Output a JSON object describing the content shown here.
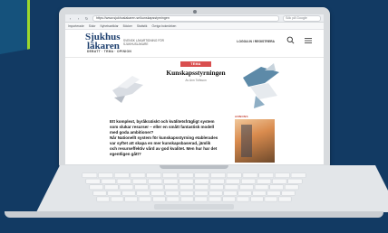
{
  "browser": {
    "url": "https://www.sjukhuslakaren.se/kunskapsstyrningen",
    "search_placeholder": "Sök på Google",
    "bookmarks": [
      "Importerade",
      "Sidor",
      "Nyhetsartiklar",
      "Böcker",
      "Statistik",
      "Övriga bokmärken"
    ]
  },
  "site": {
    "logo_line1": "Sjukhus",
    "logo_line2": "läkaren",
    "tagline": "SVENSK LÄKARTIDNING FÖR SJUKHUSLÄKARE",
    "login_label": "LOGGA IN / REGISTRERA",
    "section_nav": "DEBATT · TEMA · OPINION"
  },
  "article": {
    "tag": "TEMA",
    "title": "Kunskapsstyrningen",
    "byline": "Av Ann Tolfsson",
    "lead": "Ett komplext, byråkratiskt och kvälitetsfrägligt system som slukar resurser – eller en smått fantastisk modell med goda ambitioner?",
    "body": "Når Nationellt system för kunskapsstyrning etablerades var syftet att skapa en mer kunskapsbaserad, jämlik och resurseffektiv vård av god kvalitet. Men hur har det egentligen gått?"
  },
  "sidebar": {
    "ad_label": "ANNONS"
  },
  "colors": {
    "background": "#123a63",
    "accent": "#9bd82e",
    "tag_red": "#d94f4f",
    "logo_blue": "#1d3f6e"
  },
  "icons": [
    "search-icon",
    "menu-icon",
    "back-arrow-icon",
    "forward-arrow-icon",
    "reload-icon",
    "camera-icon"
  ]
}
